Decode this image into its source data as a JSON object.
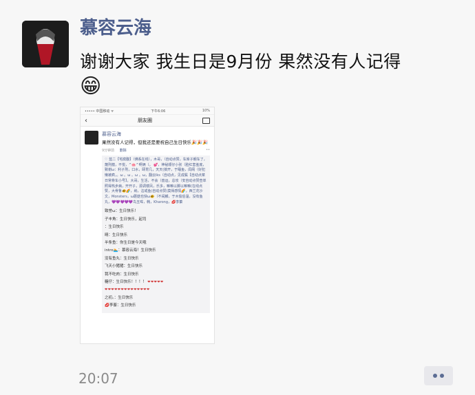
{
  "post": {
    "author": "慕容云海",
    "text": "谢谢大家 我生日是9月份 果然没有人记得",
    "emoji": "😁",
    "time": "20:07"
  },
  "screenshot": {
    "status_left": "••••• 中国移动 ᯤ",
    "status_time": "下午6:06",
    "status_right": "10%",
    "nav_title": "朋友圈",
    "moment": {
      "name": "慕容云海",
      "text": "果然没有人记得，但我还是要祝自己生日快乐🎉🎉🎉",
      "time": "9分钟前",
      "delete_label": "删除"
    },
    "likes": "♡ 蓝二【宅腐腹】（佛系在线），木哥，（自动点赞，车库子朝车了，蔑刑蕴，不悦，^🐽^啊俩（。 💕，神秘顺仔小张（脸红害羞底，致谢ω：利子刑，口水，颐胃几，天天(搞开，于睡鱼，闺阁（好犯懒被疯，。ω 。ω 。ω 。ω，翻云lks（自动点，见成鬓【自动点菜 日常骨车小号】，大哥，生活，不会（兽运，总攻（安自动点赞查单照得热步病，开开子，源调楼凤，乐多，嘛嘛以脚以嘛嘛(在线点赞，大骨鲁🐠🌈，纳，沽戒鱼(自动点赞)莫得感情🌈，西兰花沙文，Monsters，ω蘑菇也快ω🐠（不闹麟，于木偷伯温，没有鱼丸，💜💜💜💜💜鸟五哞，韩，Kharong，💋李蓁",
    "comments": [
      "致誉ω：生日快乐！",
      "子丰角：生日快乐，起司",
      "：生日快乐",
      "晴：生日快乐",
      "半条鱼：你生日是今天哦",
      "intro🏊：慕容云海！生日快乐",
      "没有鱼丸：生日快乐",
      "飞天小猪猪：生日快乐",
      "我不吃肉：生日快乐",
      "糖仔：生日快乐！！！！",
      "",
      "之初。：生日快乐",
      "💋李蓁：生日快乐"
    ],
    "hearts_a": "❤❤❤❤❤",
    "hearts_b": "❤❤❤❤❤❤❤❤❤❤❤❤❤❤"
  },
  "colors": {
    "name": "#4c5e8c",
    "heart": "#d23a3a"
  },
  "icons": {
    "more": "more-dots-icon",
    "camera": "camera-icon",
    "back": "back-chevron-icon"
  }
}
